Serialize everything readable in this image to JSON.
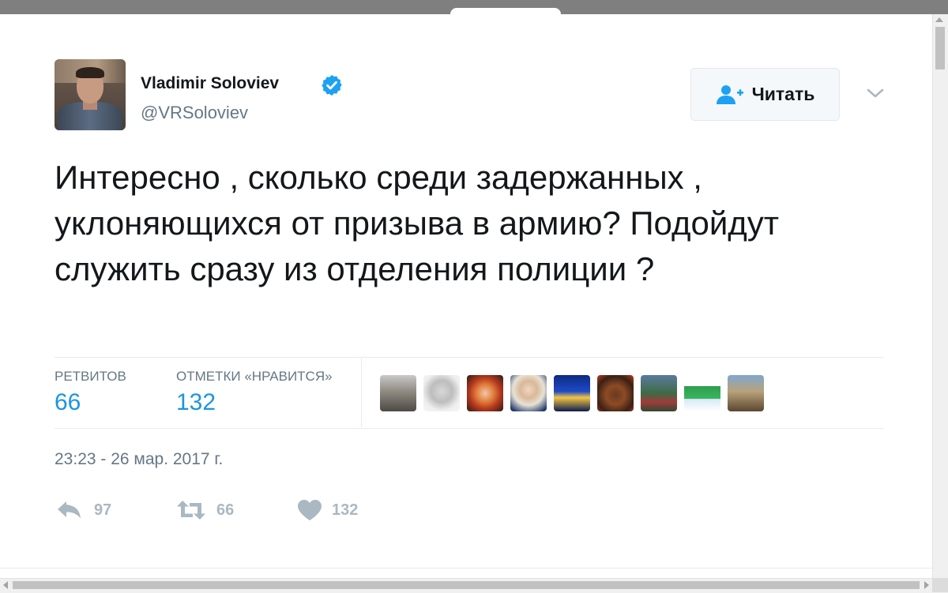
{
  "tweet": {
    "author": {
      "display_name": "Vladimir Soloviev",
      "username": "@VRSoloviev",
      "verified": true
    },
    "follow_button_label": "Читать",
    "text": "Интересно , сколько среди задержанных , уклоняющихся от призыва в армию? Подойдут служить сразу из отделения полиции ?",
    "stats": {
      "retweets_label": "РЕТВИТОВ",
      "retweets_value": "66",
      "likes_label": "ОТМЕТКИ «НРАВИТСЯ»",
      "likes_value": "132"
    },
    "timestamp": "23:23 - 26 мар. 2017 г.",
    "actions": {
      "reply_count": "97",
      "retweet_count": "66",
      "like_count": "132"
    }
  },
  "colors": {
    "accent": "#1b95e0",
    "text_primary": "#14171a",
    "text_secondary": "#657786",
    "action_gray": "#aab8c2",
    "verified_blue": "#1da1f2"
  },
  "icons": [
    "follow-user-icon",
    "verified-badge-icon",
    "chevron-down-icon",
    "reply-icon",
    "retweet-icon",
    "heart-icon"
  ]
}
